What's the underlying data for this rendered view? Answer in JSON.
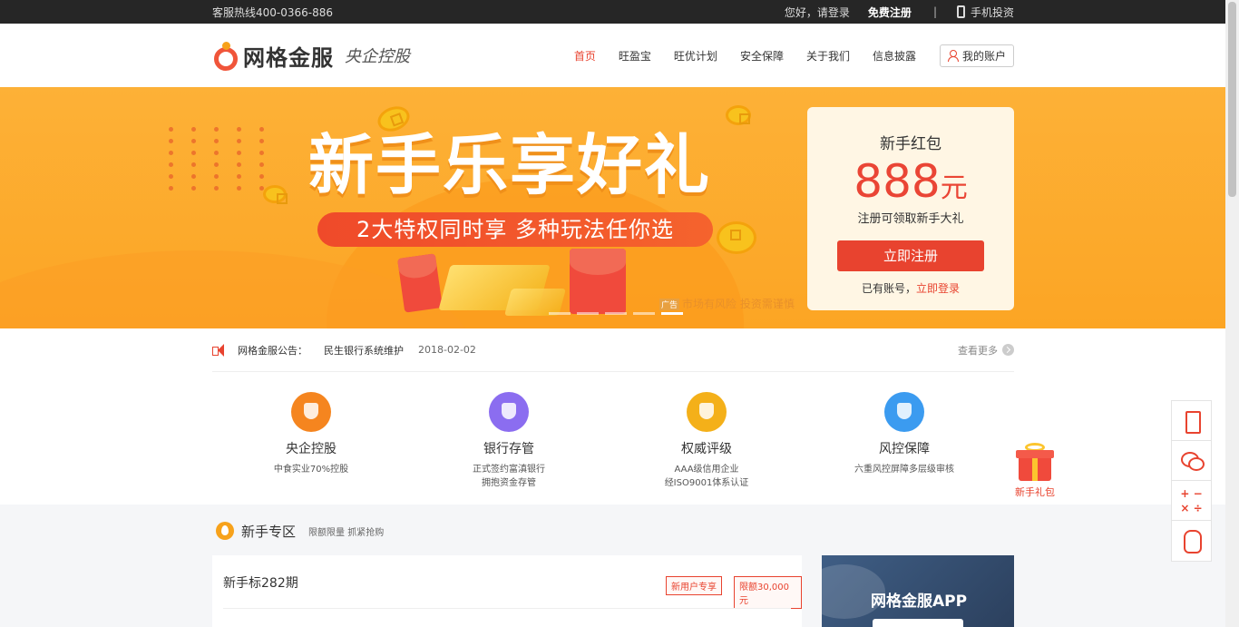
{
  "topbar": {
    "hotline": "客服热线400-0366-886",
    "greeting": "您好，请登录",
    "register": "免费注册",
    "separator": "|",
    "mobile": "手机投资"
  },
  "header": {
    "logo_text": "网格金服",
    "logo_sub": "央企控股",
    "nav": [
      "首页",
      "旺盈宝",
      "旺优计划",
      "安全保障",
      "关于我们",
      "信息披露"
    ],
    "account": "我的账户"
  },
  "banner": {
    "headline": "新手乐享好礼",
    "ribbon": "2大特权同时享  多种玩法任你选",
    "ad_tag": "广告",
    "risk_note": "市场有风险 投资需谨慎",
    "slides": 5,
    "active_slide": 5
  },
  "promo": {
    "title": "新手红包",
    "amount": "888",
    "unit": "元",
    "desc": "注册可领取新手大礼",
    "button": "立即注册",
    "login_prefix": "已有账号，",
    "login_link": "立即登录"
  },
  "notice": {
    "label": "网格金服公告：",
    "item": "民生银行系统维护",
    "date": "2018-02-02",
    "more": "查看更多"
  },
  "features": [
    {
      "name": "央企控股",
      "desc1": "中食实业70%控股",
      "desc2": "",
      "color": "#f5851f"
    },
    {
      "name": "银行存管",
      "desc1": "正式签约富滇银行",
      "desc2": "拥抱资金存管",
      "color": "#8b6df0"
    },
    {
      "name": "权威评级",
      "desc1": "AAA级信用企业",
      "desc2": "经ISO9001体系认证",
      "color": "#f4b019"
    },
    {
      "name": "风控保障",
      "desc1": "六重风控屏障多层级审核",
      "desc2": "",
      "color": "#3b9bf0"
    }
  ],
  "section": {
    "title": "新手专区",
    "subtitle": "限额限量 抓紧抢购"
  },
  "product": {
    "name": "新手标282期",
    "tag1": "新用户专享",
    "tag2": "限额30,000元"
  },
  "app_card": {
    "title": "网格金服APP"
  },
  "sidebar": {
    "calc": "+ −\n× ÷"
  },
  "gift": {
    "label": "新手礼包"
  },
  "colors": {
    "brand_red": "#e8432f",
    "banner_orange": "#fdb137",
    "promo_bg": "#fff6e4"
  }
}
